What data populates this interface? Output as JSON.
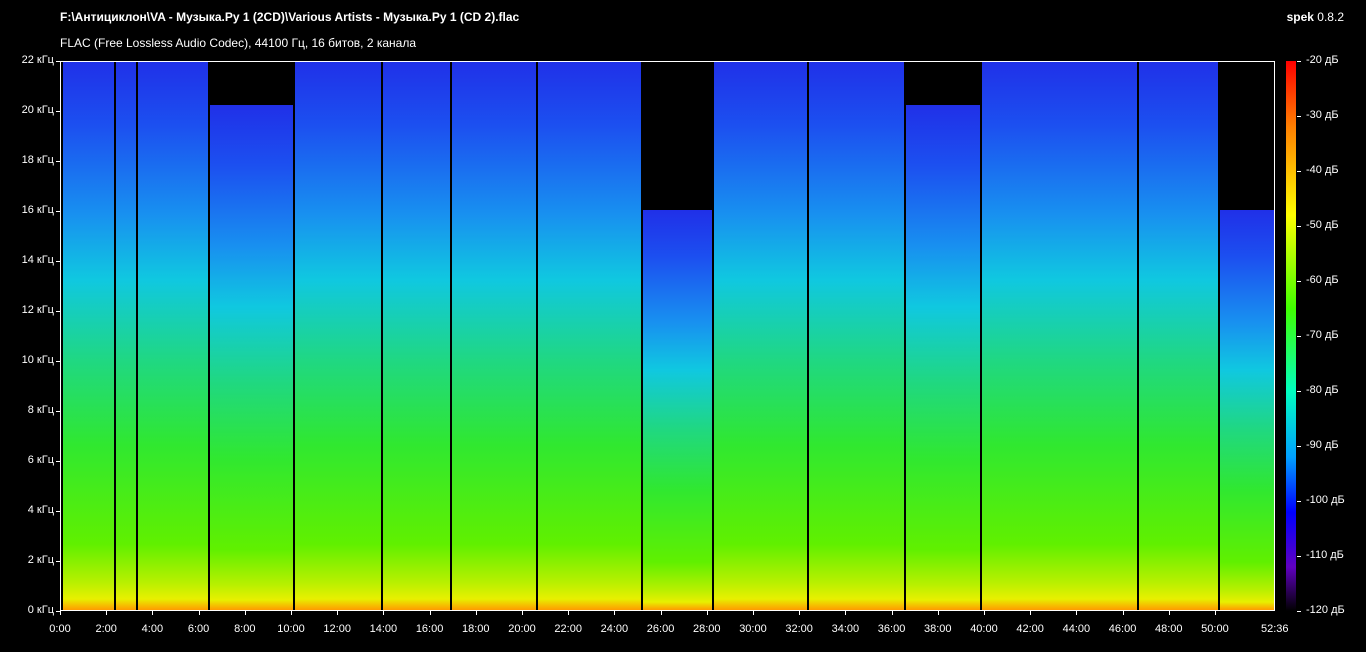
{
  "header": {
    "title": "F:\\Антициклон\\VA - Музыка.Ру 1 (2CD)\\Various Artists - Музыка.Ру 1 (CD 2).flac",
    "subtitle": "FLAC (Free Lossless Audio Codec), 44100 Гц, 16 битов, 2 канала",
    "app": "spek",
    "version": "0.8.2"
  },
  "chart_data": {
    "type": "heatmap",
    "title": "Spectrogram",
    "duration_min": 52.6,
    "xlim": [
      0,
      52.6
    ],
    "ylim": [
      0,
      22
    ],
    "x_ticks": [
      "0:00",
      "2:00",
      "4:00",
      "6:00",
      "8:00",
      "10:00",
      "12:00",
      "14:00",
      "16:00",
      "18:00",
      "20:00",
      "22:00",
      "24:00",
      "26:00",
      "28:00",
      "30:00",
      "32:00",
      "34:00",
      "36:00",
      "38:00",
      "40:00",
      "42:00",
      "44:00",
      "46:00",
      "48:00",
      "50:00"
    ],
    "x_end_label": "52:36",
    "y_ticks": [
      "0 кГц",
      "2 кГц",
      "4 кГц",
      "6 кГц",
      "8 кГц",
      "10 кГц",
      "12 кГц",
      "14 кГц",
      "16 кГц",
      "18 кГц",
      "20 кГц",
      "22 кГц"
    ],
    "colorbar_ticks": [
      "-20 дБ",
      "-30 дБ",
      "-40 дБ",
      "-50 дБ",
      "-60 дБ",
      "-70 дБ",
      "-80 дБ",
      "-90 дБ",
      "-100 дБ",
      "-110 дБ",
      "-120 дБ"
    ],
    "tracks": [
      {
        "start_min": 0,
        "cutoff_khz": 22
      },
      {
        "start_min": 2.3,
        "cutoff_khz": 22
      },
      {
        "start_min": 3.25,
        "cutoff_khz": 22
      },
      {
        "start_min": 6.36,
        "cutoff_khz": 20.2
      },
      {
        "start_min": 10.04,
        "cutoff_khz": 22
      },
      {
        "start_min": 13.85,
        "cutoff_khz": 22
      },
      {
        "start_min": 16.84,
        "cutoff_khz": 22
      },
      {
        "start_min": 20.56,
        "cutoff_khz": 22
      },
      {
        "start_min": 25.1,
        "cutoff_khz": 16
      },
      {
        "start_min": 28.2,
        "cutoff_khz": 22
      },
      {
        "start_min": 32.3,
        "cutoff_khz": 22
      },
      {
        "start_min": 36.5,
        "cutoff_khz": 20.2
      },
      {
        "start_min": 39.8,
        "cutoff_khz": 22
      },
      {
        "start_min": 46.6,
        "cutoff_khz": 22
      },
      {
        "start_min": 50.1,
        "cutoff_khz": 16
      }
    ]
  }
}
